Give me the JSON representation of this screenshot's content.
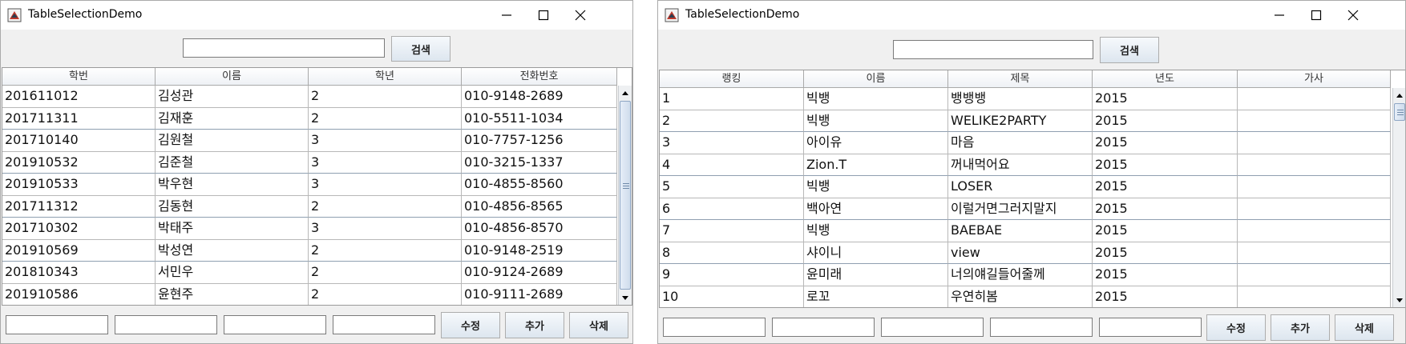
{
  "window1": {
    "title": "TableSelectionDemo",
    "search": {
      "value": "",
      "button_label": "검색"
    },
    "table": {
      "columns": [
        "학번",
        "이름",
        "학년",
        "전화번호"
      ],
      "rows": [
        [
          "201611012",
          "김성관",
          "2",
          "010-9148-2689"
        ],
        [
          "201711311",
          "김재훈",
          "2",
          "010-5511-1034"
        ],
        [
          "201710140",
          "김원철",
          "3",
          "010-7757-1256"
        ],
        [
          "201910532",
          "김준철",
          "3",
          "010-3215-1337"
        ],
        [
          "201910533",
          "박우현",
          "3",
          "010-4855-8560"
        ],
        [
          "201711312",
          "김동현",
          "2",
          "010-4856-8565"
        ],
        [
          "201710302",
          "박태주",
          "3",
          "010-4856-8570"
        ],
        [
          "201910569",
          "박성연",
          "2",
          "010-9148-2519"
        ],
        [
          "201810343",
          "서민우",
          "2",
          "010-9124-2689"
        ],
        [
          "201910586",
          "윤현주",
          "2",
          "010-9111-2689"
        ]
      ]
    },
    "buttons": {
      "edit": "수정",
      "add": "추가",
      "delete": "삭제"
    }
  },
  "window2": {
    "title": "TableSelectionDemo",
    "search": {
      "value": "",
      "button_label": "검색"
    },
    "table": {
      "columns": [
        "랭킹",
        "이름",
        "제목",
        "년도",
        "가사"
      ],
      "rows": [
        [
          "1",
          "빅뱅",
          "뱅뱅뱅",
          "2015",
          ""
        ],
        [
          "2",
          "빅뱅",
          "WELIKE2PARTY",
          "2015",
          ""
        ],
        [
          "3",
          "아이유",
          "마음",
          "2015",
          ""
        ],
        [
          "4",
          "Zion.T",
          "꺼내먹어요",
          "2015",
          ""
        ],
        [
          "5",
          "빅뱅",
          "LOSER",
          "2015",
          ""
        ],
        [
          "6",
          "백아연",
          "이럴거면그러지말지",
          "2015",
          ""
        ],
        [
          "7",
          "빅뱅",
          "BAEBAE",
          "2015",
          ""
        ],
        [
          "8",
          "샤이니",
          "view",
          "2015",
          ""
        ],
        [
          "9",
          "윤미래",
          "너의얘길들어줄께",
          "2015",
          ""
        ],
        [
          "10",
          "로꼬",
          "우연히봄",
          "2015",
          ""
        ]
      ]
    },
    "buttons": {
      "edit": "수정",
      "add": "추가",
      "delete": "삭제"
    }
  }
}
